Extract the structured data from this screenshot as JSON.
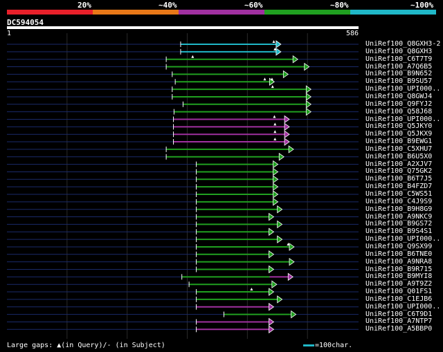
{
  "legend": {
    "labels": [
      "20%",
      "~40%",
      "~60%",
      "~80%",
      "~100%"
    ],
    "colors": [
      "#e8202a",
      "#e87818",
      "#a030a0",
      "#20a020",
      "#20b8c8"
    ]
  },
  "query": {
    "id": "DC594054",
    "start": "1",
    "end": "586",
    "length": 586
  },
  "footer": {
    "gaps_text": "Large gaps: ▲(in Query)/- (in Subject)",
    "scale_text": "=100char."
  },
  "hits": [
    {
      "id": "UniRef100_Q8GXH3-2",
      "color": "#20b8c8",
      "start": 290,
      "end": 450,
      "gap_q": [
        445
      ]
    },
    {
      "id": "UniRef100_Q8GXH3",
      "color": "#20b8c8",
      "start": 290,
      "end": 450,
      "gap_q": [
        447
      ]
    },
    {
      "id": "UniRef100_C6T7T9",
      "color": "#20a020",
      "start": 266,
      "end": 478,
      "gap_q": [
        310
      ]
    },
    {
      "id": "UniRef100_A7Q6B5",
      "color": "#20a020",
      "start": 266,
      "end": 497,
      "gap_q": []
    },
    {
      "id": "UniRef100_B9N652",
      "color": "#20a020",
      "start": 276,
      "end": 462,
      "gap_q": []
    },
    {
      "id": "UniRef100_B9SU57",
      "color": "#20a020",
      "start": 281,
      "end": 439,
      "gap_q": [
        430,
        442
      ]
    },
    {
      "id": "UniRef100_UPI000..",
      "color": "#20a020",
      "start": 276,
      "end": 500,
      "gap_q": [
        443
      ]
    },
    {
      "id": "UniRef100_Q8GWJ4",
      "color": "#20a020",
      "start": 276,
      "end": 500,
      "gap_q": []
    },
    {
      "id": "UniRef100_Q9FYJ2",
      "color": "#20a020",
      "start": 294,
      "end": 500,
      "gap_q": []
    },
    {
      "id": "UniRef100_Q58J68",
      "color": "#20a020",
      "start": 279,
      "end": 500,
      "gap_q": []
    },
    {
      "id": "UniRef100_UPI000..",
      "color": "#a030a0",
      "start": 278,
      "end": 464,
      "gap_q": [
        446
      ]
    },
    {
      "id": "UniRef100_Q5JKY0",
      "color": "#a030a0",
      "start": 278,
      "end": 464,
      "gap_q": [
        447
      ]
    },
    {
      "id": "UniRef100_Q5JKX9",
      "color": "#a030a0",
      "start": 278,
      "end": 464,
      "gap_q": [
        447
      ]
    },
    {
      "id": "UniRef100_B9EWG1",
      "color": "#a030a0",
      "start": 278,
      "end": 464,
      "gap_q": [
        447
      ]
    },
    {
      "id": "UniRef100_C5XHU7",
      "color": "#20a020",
      "start": 266,
      "end": 471,
      "gap_q": []
    },
    {
      "id": "UniRef100_B6U5X0",
      "color": "#20a020",
      "start": 266,
      "end": 455,
      "gap_q": []
    },
    {
      "id": "UniRef100_A2XJV7",
      "color": "#20a020",
      "start": 316,
      "end": 445,
      "gap_q": []
    },
    {
      "id": "UniRef100_Q75GK2",
      "color": "#20a020",
      "start": 316,
      "end": 445,
      "gap_q": []
    },
    {
      "id": "UniRef100_B6T7J5",
      "color": "#20a020",
      "start": 316,
      "end": 445,
      "gap_q": []
    },
    {
      "id": "UniRef100_B4FZD7",
      "color": "#20a020",
      "start": 316,
      "end": 445,
      "gap_q": []
    },
    {
      "id": "UniRef100_C5WS51",
      "color": "#20a020",
      "start": 316,
      "end": 445,
      "gap_q": []
    },
    {
      "id": "UniRef100_C4J9S9",
      "color": "#20a020",
      "start": 316,
      "end": 445,
      "gap_q": []
    },
    {
      "id": "UniRef100_B9H8G9",
      "color": "#20a020",
      "start": 316,
      "end": 452,
      "gap_q": []
    },
    {
      "id": "UniRef100_A9NKC9",
      "color": "#20a020",
      "start": 316,
      "end": 438,
      "gap_q": []
    },
    {
      "id": "UniRef100_B9GS72",
      "color": "#20a020",
      "start": 316,
      "end": 452,
      "gap_q": []
    },
    {
      "id": "UniRef100_B9S4S1",
      "color": "#20a020",
      "start": 316,
      "end": 438,
      "gap_q": []
    },
    {
      "id": "UniRef100_UPI000..",
      "color": "#20a020",
      "start": 316,
      "end": 452,
      "gap_q": []
    },
    {
      "id": "UniRef100_Q9SX99",
      "color": "#20a020",
      "start": 316,
      "end": 472,
      "gap_q": [
        469
      ]
    },
    {
      "id": "UniRef100_B6TNE0",
      "color": "#20a020",
      "start": 316,
      "end": 438,
      "gap_q": []
    },
    {
      "id": "UniRef100_A9NRA8",
      "color": "#20a020",
      "start": 316,
      "end": 472,
      "gap_q": []
    },
    {
      "id": "UniRef100_B9R715",
      "color": "#20a020",
      "start": 316,
      "end": 438,
      "gap_q": []
    },
    {
      "id": "UniRef100_B9MYI8",
      "color": "#20a020",
      "start": 292,
      "end": 470,
      "gap_q": [],
      "purple_from": 438
    },
    {
      "id": "UniRef100_A9T9Z2",
      "color": "#20a020",
      "start": 304,
      "end": 443,
      "gap_q": []
    },
    {
      "id": "UniRef100_Q01FS1",
      "color": "#20a020",
      "start": 316,
      "end": 438,
      "gap_q": [
        408
      ]
    },
    {
      "id": "UniRef100_C1EJB6",
      "color": "#20a020",
      "start": 316,
      "end": 452,
      "gap_q": []
    },
    {
      "id": "UniRef100_UPI000..",
      "color": "#a030a0",
      "start": 316,
      "end": 438,
      "gap_q": []
    },
    {
      "id": "UniRef100_C6T9D1",
      "color": "#20a020",
      "start": 362,
      "end": 475,
      "gap_q": []
    },
    {
      "id": "UniRef100_A7NTP7",
      "color": "#a030a0",
      "start": 316,
      "end": 438,
      "gap_q": []
    },
    {
      "id": "UniRef100_A5BBP0",
      "color": "#a030a0",
      "start": 316,
      "end": 438,
      "gap_q": []
    }
  ]
}
